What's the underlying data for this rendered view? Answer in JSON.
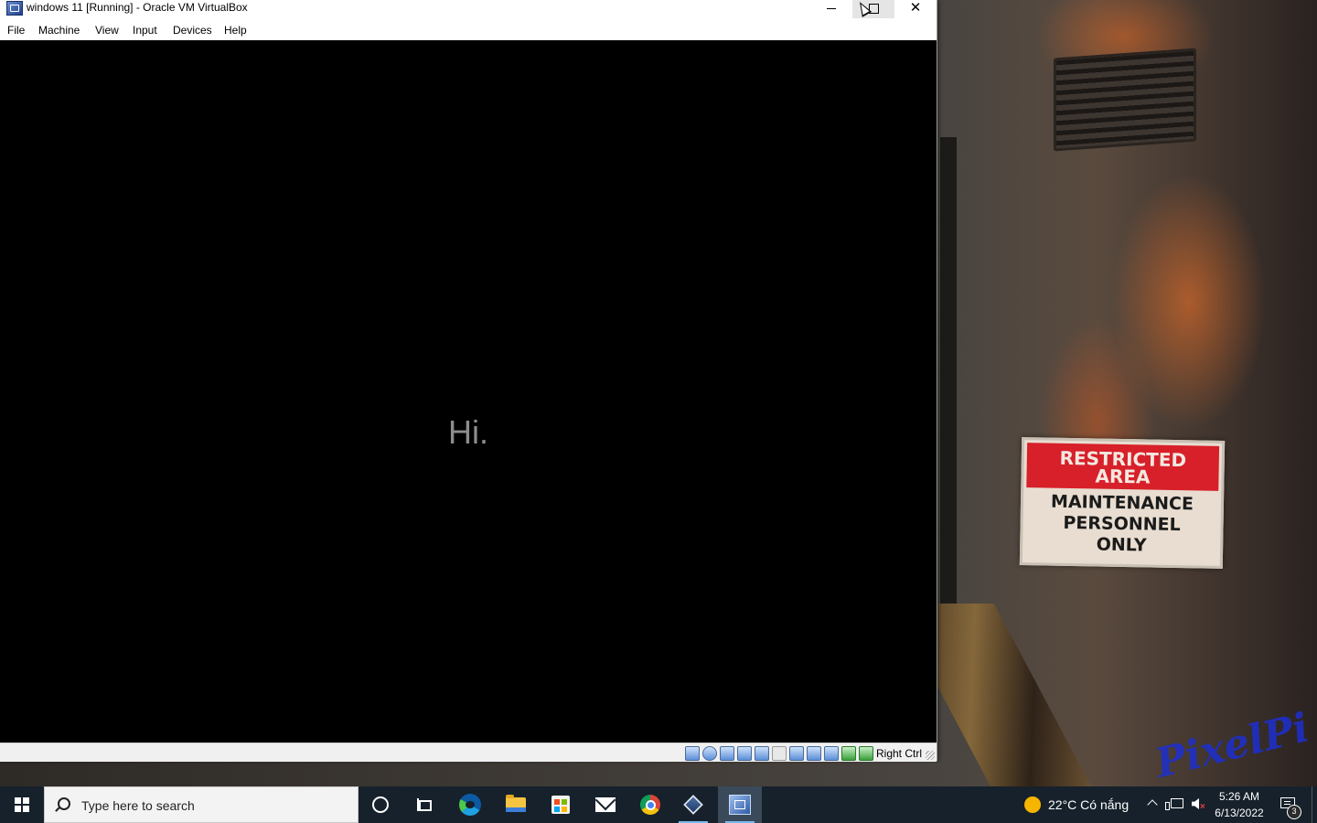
{
  "window": {
    "title": "windows 11 [Running] - Oracle VM VirtualBox",
    "controls": {
      "minimize": "minimize",
      "maximize": "maximize",
      "close": "✕"
    }
  },
  "menu": {
    "items": [
      {
        "label": "File"
      },
      {
        "label": "Machine"
      },
      {
        "label": "View"
      },
      {
        "label": "Input"
      },
      {
        "label": "Devices"
      },
      {
        "label": "Help"
      }
    ]
  },
  "vm_screen": {
    "greeting": "Hi."
  },
  "status_bar": {
    "icons": [
      "hard-disk-icon",
      "optical-drive-icon",
      "audio-icon",
      "network-icon",
      "usb-icon",
      "shared-folders-icon",
      "display-icon",
      "video-capture-icon",
      "recording-icon",
      "virtualization-icon",
      "mouse-integration-icon",
      "keyboard-icon"
    ],
    "host_key": "Right Ctrl"
  },
  "wallpaper": {
    "sign": {
      "top_line1": "RESTRICTED",
      "top_line2": "AREA",
      "line1": "MAINTENANCE",
      "line2": "PERSONNEL",
      "line3": "ONLY"
    },
    "watermark": "PixelPi"
  },
  "taskbar": {
    "search_placeholder": "Type here to search",
    "pinned": [
      "cortana-icon",
      "task-view-icon",
      "edge-icon",
      "file-explorer-icon",
      "microsoft-store-icon",
      "mail-icon",
      "chrome-icon",
      "virtualbox-icon",
      "virtualbox-vm-icon"
    ],
    "weather": "22°C  Có nắng",
    "time": "5:26 AM",
    "date": "6/13/2022",
    "notification_count": "3",
    "accent_color": "#76b9ed"
  }
}
